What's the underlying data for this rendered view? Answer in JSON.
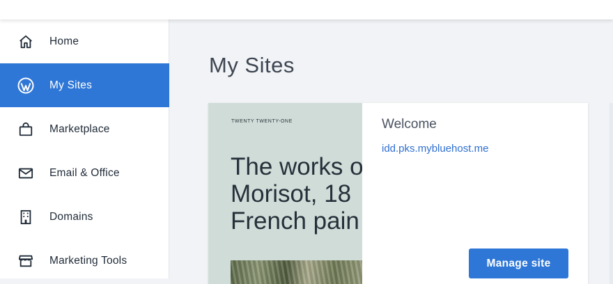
{
  "sidebar": {
    "items": [
      {
        "label": "Home",
        "icon": "home-icon",
        "active": false
      },
      {
        "label": "My Sites",
        "icon": "wordpress-icon",
        "active": true
      },
      {
        "label": "Marketplace",
        "icon": "shopping-bag-icon",
        "active": false
      },
      {
        "label": "Email & Office",
        "icon": "envelope-icon",
        "active": false
      },
      {
        "label": "Domains",
        "icon": "building-icon",
        "active": false
      },
      {
        "label": "Marketing Tools",
        "icon": "store-icon",
        "active": false
      }
    ]
  },
  "main": {
    "title": "My Sites",
    "site_card": {
      "preview": {
        "theme_name": "TWENTY TWENTY-ONE",
        "headline_lines": [
          "The works of",
          "Morisot, 18",
          "French pain"
        ]
      },
      "welcome": "Welcome",
      "url": "idd.pks.mybluehost.me",
      "manage_label": "Manage site"
    }
  },
  "colors": {
    "accent": "#2f77d6",
    "link": "#2f6fd1",
    "preview_bg": "#cfdcd8"
  }
}
